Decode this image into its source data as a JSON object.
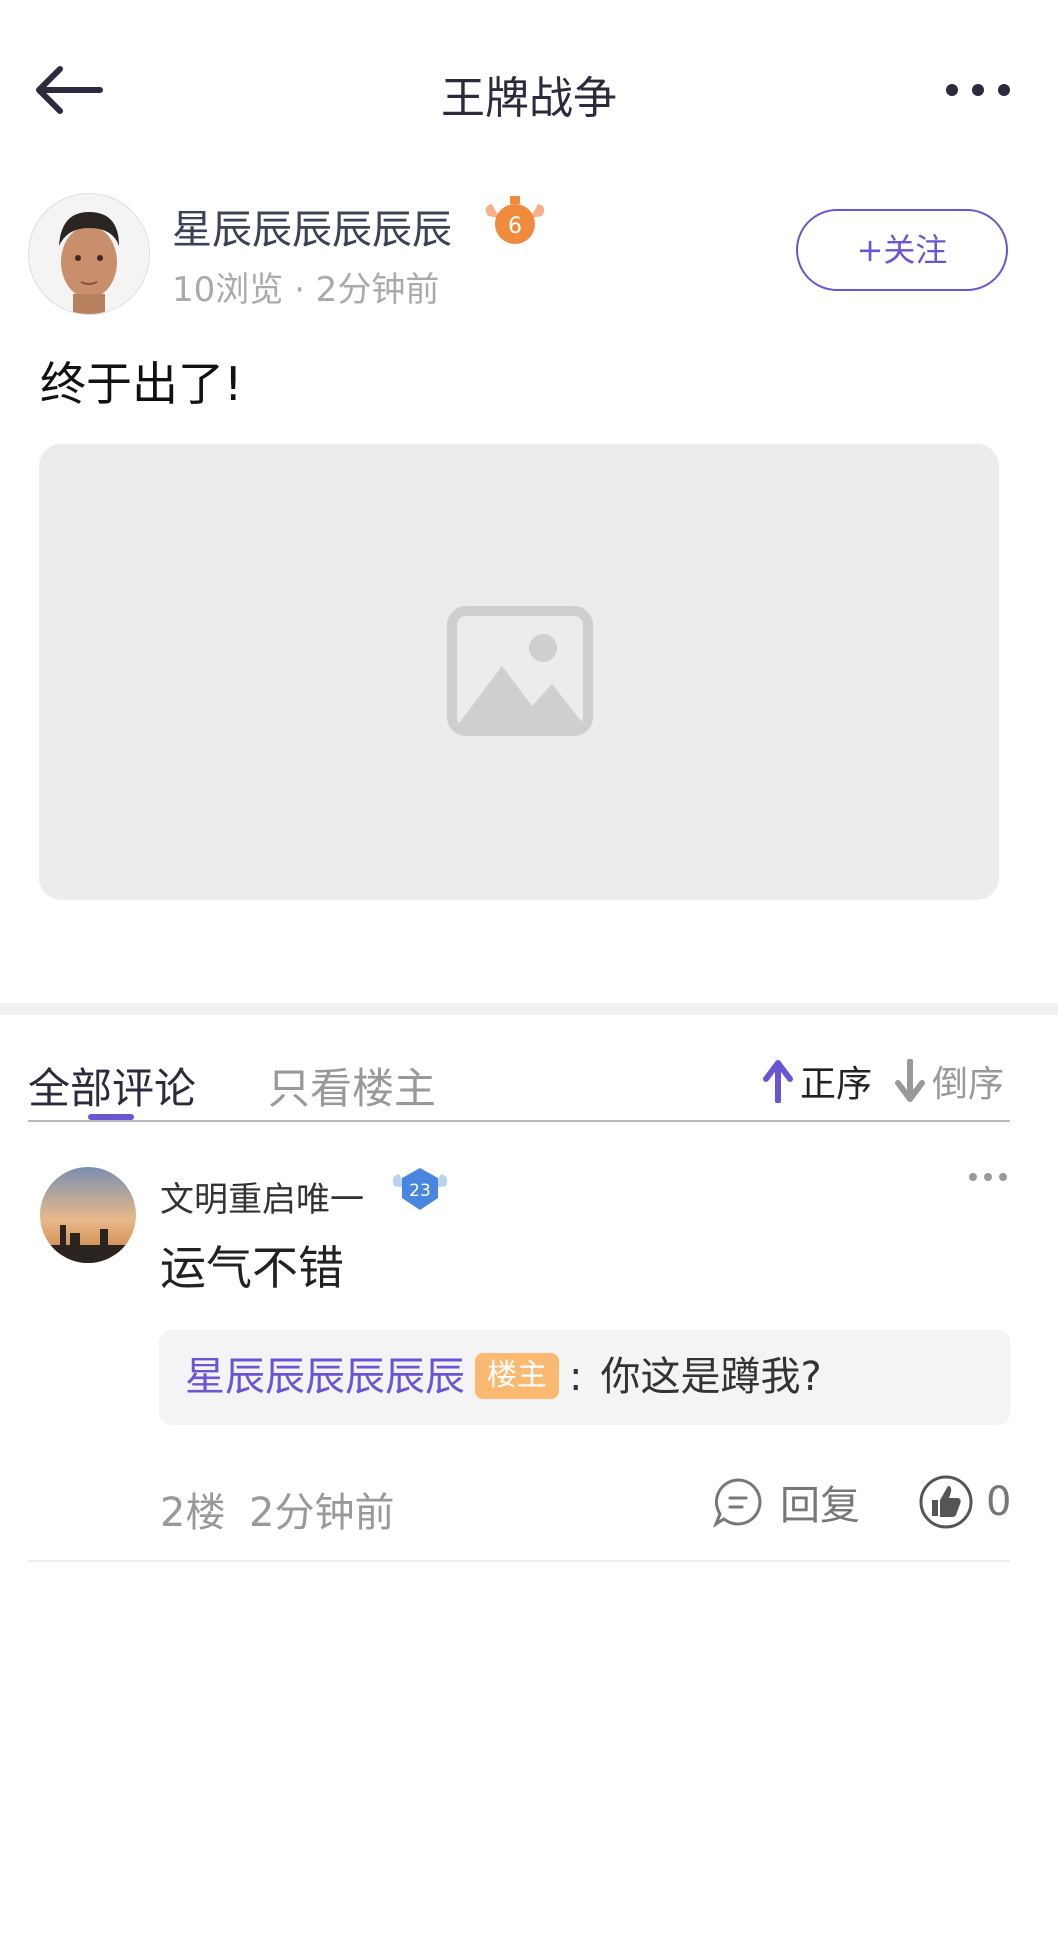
{
  "header": {
    "title": "王牌战争"
  },
  "post": {
    "author": "星辰辰辰辰辰辰",
    "author_level": "6",
    "meta": "10浏览 · 2分钟前",
    "follow_label": "+关注",
    "text": "终于出了!"
  },
  "tabs": {
    "all": "全部评论",
    "owner_only": "只看楼主"
  },
  "sort": {
    "asc": "正序",
    "desc": "倒序"
  },
  "comment": {
    "author": "文明重启唯一",
    "level": "23",
    "text": "运气不错",
    "reply": {
      "author": "星辰辰辰辰辰辰",
      "tag": "楼主",
      "colon": ":",
      "text": "你这是蹲我?"
    },
    "floor": "2楼",
    "time": "2分钟前",
    "reply_label": "回复",
    "likes": "0"
  },
  "colors": {
    "accent": "#6b55d3",
    "owner_tag": "#f9b970"
  }
}
